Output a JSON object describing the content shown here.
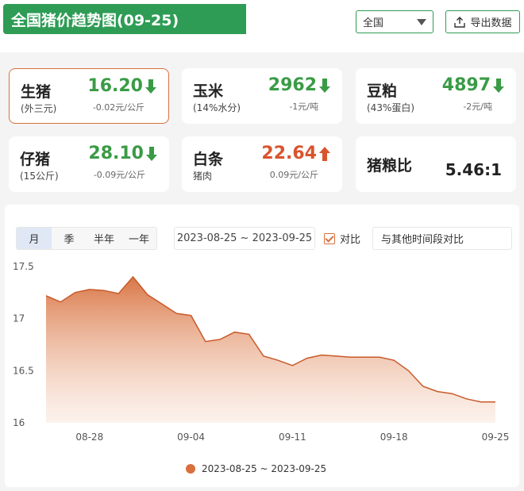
{
  "header": {
    "title": "全国猪价趋势图(09-25)",
    "region_select": "全国",
    "export_label": "导出数据"
  },
  "cards": {
    "pig": {
      "name": "生猪",
      "sub": "(外三元)",
      "price": "16.20",
      "change": "-0.02元/公斤",
      "trend": "down"
    },
    "corn": {
      "name": "玉米",
      "sub": "(14%水分)",
      "price": "2962",
      "change": "-1元/吨",
      "trend": "down"
    },
    "soymeal": {
      "name": "豆粕",
      "sub": "(43%蛋白)",
      "price": "4897",
      "change": "-2元/吨",
      "trend": "down"
    },
    "piglet": {
      "name": "仔猪",
      "sub": "(15公斤)",
      "price": "28.10",
      "change": "-0.09元/公斤",
      "trend": "down"
    },
    "carcass": {
      "name": "白条",
      "sub": "猪肉",
      "price": "22.64",
      "change": "0.09元/公斤",
      "trend": "up"
    },
    "ratio": {
      "name": "猪粮比",
      "value": "5.46:1"
    }
  },
  "colors": {
    "brand_green": "#2e9c55",
    "down_green": "#3a9b46",
    "up_red": "#d9542e",
    "series": "#d7703d"
  },
  "chart_controls": {
    "tabs": [
      "月",
      "季",
      "半年",
      "一年"
    ],
    "active_tab": "月",
    "date_range": "2023-08-25 ~ 2023-09-25",
    "compare_label": "对比",
    "compare_checked": true,
    "compare_other": "与其他时间段对比"
  },
  "chart_data": {
    "type": "area",
    "x": [
      "08-25",
      "08-26",
      "08-27",
      "08-28",
      "08-29",
      "08-30",
      "08-31",
      "09-01",
      "09-02",
      "09-03",
      "09-04",
      "09-05",
      "09-06",
      "09-07",
      "09-08",
      "09-09",
      "09-10",
      "09-11",
      "09-12",
      "09-13",
      "09-14",
      "09-15",
      "09-16",
      "09-17",
      "09-18",
      "09-19",
      "09-20",
      "09-21",
      "09-22",
      "09-23",
      "09-24",
      "09-25"
    ],
    "x_ticks": [
      "08-28",
      "09-04",
      "09-11",
      "09-18",
      "09-25"
    ],
    "y_ticks": [
      "16",
      "16.5",
      "17",
      "17.5"
    ],
    "ylim": [
      16,
      17.5
    ],
    "series": [
      {
        "name": "2023-08-25 ~ 2023-09-25",
        "values": [
          17.22,
          17.16,
          17.25,
          17.28,
          17.27,
          17.24,
          17.4,
          17.23,
          17.14,
          17.05,
          17.03,
          16.78,
          16.8,
          16.87,
          16.85,
          16.64,
          16.6,
          16.55,
          16.62,
          16.65,
          16.64,
          16.63,
          16.63,
          16.63,
          16.6,
          16.5,
          16.35,
          16.3,
          16.28,
          16.23,
          16.2,
          16.2
        ]
      }
    ],
    "legend_position": "bottom",
    "grid": false
  }
}
